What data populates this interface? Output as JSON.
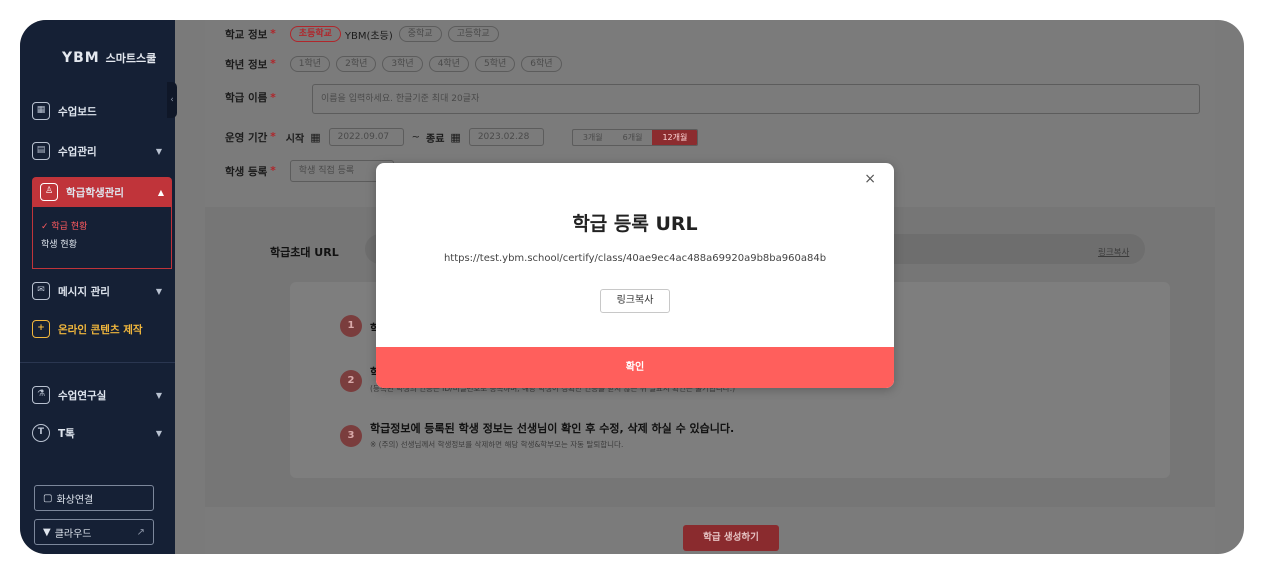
{
  "brand": {
    "logo_mark": "YBM",
    "logo_text": "스마트스쿨"
  },
  "sidebar": {
    "collapse_glyph": "‹",
    "items": [
      {
        "label": "수업보드",
        "icon": "board-icon"
      },
      {
        "label": "수업관리",
        "icon": "class-icon",
        "caret": "▼"
      },
      {
        "label": "학급학생관리",
        "icon": "students-icon",
        "caret": "▲"
      },
      {
        "label": "메시지 관리",
        "icon": "message-icon",
        "caret": "▼"
      },
      {
        "label": "온라인 콘텐츠 제작",
        "icon": "content-icon"
      },
      {
        "label": "수업연구실",
        "icon": "microscope-icon",
        "caret": "▼"
      },
      {
        "label": "T톡",
        "icon": "talk-icon",
        "caret": "▼"
      }
    ],
    "subitems": [
      "✓ 학급 현황",
      "학생 현황"
    ],
    "buttons": [
      {
        "label": "화상연결",
        "icon": "video-icon"
      },
      {
        "label": "클라우드",
        "icon": "cloud-icon",
        "ext": "↗"
      }
    ]
  },
  "form": {
    "school_label": "학교 정보",
    "school_options": [
      "초등학교",
      "YBM(초등)",
      "중학교",
      "고등학교"
    ],
    "grade_label": "학년 정보",
    "grade_options": [
      "1학년",
      "2학년",
      "3학년",
      "4학년",
      "5학년",
      "6학년"
    ],
    "class_name_label": "학급 이름",
    "class_name_placeholder": "이름을 입력하세요. 한글기준 최대 20글자",
    "period_label": "운영 기간",
    "start_label": "시작",
    "start_date": "2022.09.07",
    "tilde": "~",
    "end_label": "종료",
    "end_date": "2023.02.28",
    "period_options": [
      "3개월",
      "6개월",
      "12개월"
    ],
    "student_label": "학생 등록",
    "student_button": "학생 직접 등록",
    "required_mark": "*"
  },
  "invite": {
    "label": "학급초대 URL",
    "copy_link": "링크복사",
    "steps": [
      {
        "num": "1",
        "text": "학",
        "note": ""
      },
      {
        "num": "2",
        "text": "학",
        "note": "(등록된 학생의 인증은 ID/비밀번호로 등록하며, 해당 학생이 정확한 인증을 받지 않은 뒤 필요시 확인은 불가합니다.)"
      },
      {
        "num": "3",
        "text": "학급정보에 등록된 학생 정보는 선생님이 확인 후 수정, 삭제 하실 수 있습니다.",
        "note": "※ (주의) 선생님께서 학생정보를 삭제하면 해당 학생&학부모는 자동 탈퇴합니다."
      }
    ],
    "create_button": "학급 생성하기"
  },
  "modal": {
    "close": "×",
    "title": "학급 등록 URL",
    "url": "https://test.ybm.school/certify/class/40ae9ec4ac488a69920a9b8ba960a84b",
    "copy_button": "링크복사",
    "confirm_button": "확인"
  }
}
